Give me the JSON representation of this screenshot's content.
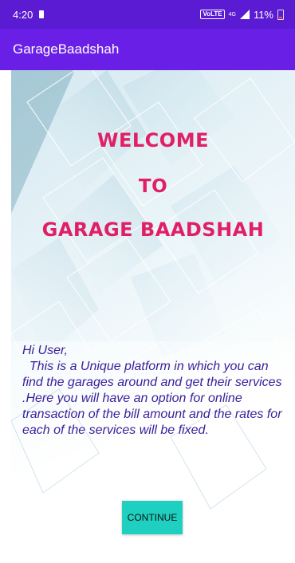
{
  "status_bar": {
    "time": "4:20",
    "network_tag": "VoLTE",
    "signal_tag": "4G",
    "battery": "11%"
  },
  "app_bar": {
    "title": "GarageBaadshah"
  },
  "welcome": {
    "line1": "WELCOME",
    "line2": "TO",
    "line3": "GARAGE BAADSHAH"
  },
  "intro": {
    "greeting": "Hi User,",
    "body": "This is a Unique platform in which you can find the garages around and get their services .Here you will have an option for online transaction of the bill amount and the rates for each of the services will be fixed."
  },
  "continue_button": {
    "label": "CONTINUE"
  },
  "colors": {
    "status_bar": "#5a1bd3",
    "app_bar": "#6a1fe6",
    "heading": "#e01f65",
    "body_text": "#3a1f9a",
    "button": "#1fd0c0"
  }
}
